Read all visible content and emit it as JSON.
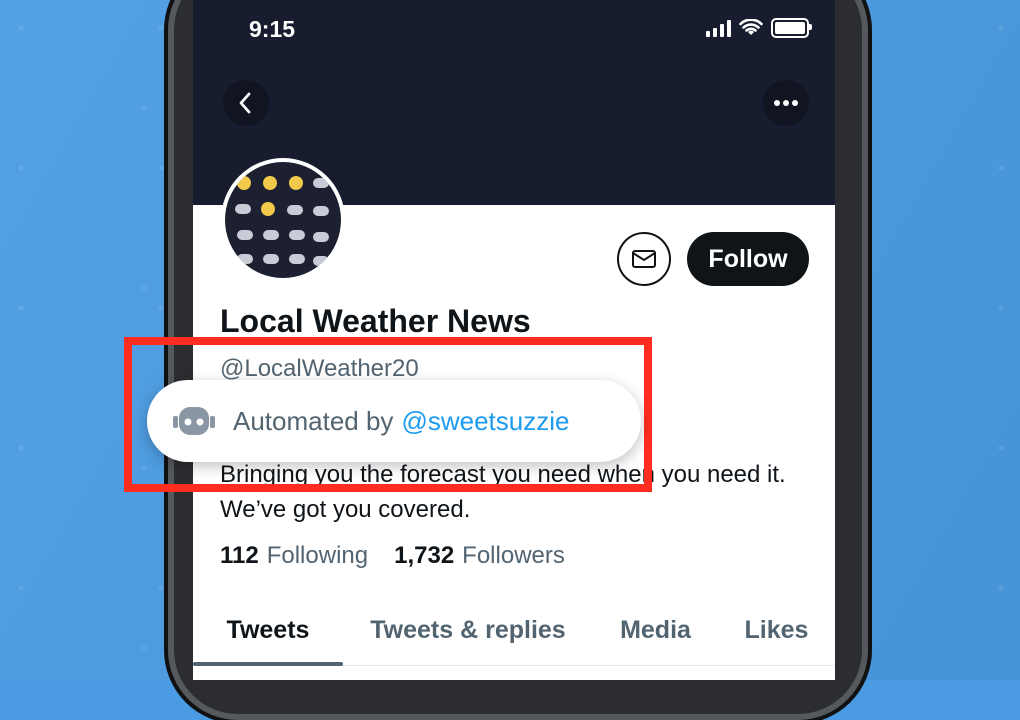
{
  "status_bar": {
    "time": "9:15"
  },
  "header": {
    "back_icon": "chevron-left-icon",
    "more_icon": "more-horizontal-icon"
  },
  "profile": {
    "name": "Local Weather News",
    "handle": "@LocalWeather20",
    "bio": "Bringing you the forecast you need when you need it.  We’ve got you covered.",
    "following_count": "112",
    "following_label": "Following",
    "followers_count": "1,732",
    "followers_label": "Followers"
  },
  "actions": {
    "follow_label": "Follow",
    "message_icon": "mail-icon"
  },
  "automated": {
    "label": "Automated by",
    "account": "@sweetsuzzie",
    "icon": "robot-icon"
  },
  "tabs": [
    {
      "label": "Tweets",
      "active": true
    },
    {
      "label": "Tweets & replies",
      "active": false
    },
    {
      "label": "Media",
      "active": false
    },
    {
      "label": "Likes",
      "active": false
    }
  ],
  "colors": {
    "background": "#4a9be3",
    "header": "#171c2e",
    "highlight": "#ff2d20",
    "link": "#1d9bf0",
    "follow_button": "#0f1419"
  }
}
